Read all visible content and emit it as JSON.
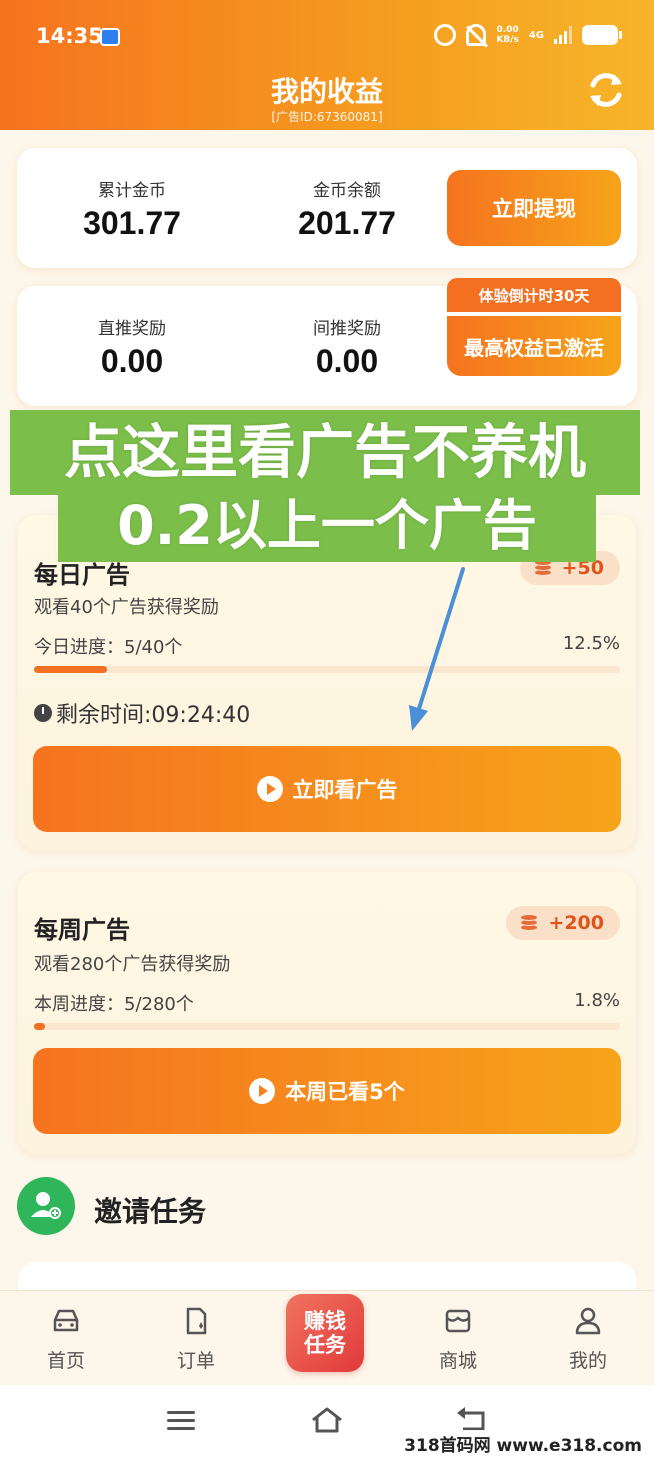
{
  "status_bar": {
    "time": "14:35",
    "net_speed_value": "0.00",
    "net_speed_unit": "KB/s",
    "network": "4G"
  },
  "header": {
    "title": "我的收益",
    "ad_id": "[广告ID:67360081]"
  },
  "balance_card": {
    "total_coins_label": "累计金币",
    "total_coins_value": "301.77",
    "coin_balance_label": "金币余额",
    "coin_balance_value": "201.77",
    "withdraw_button": "立即提现"
  },
  "reward_card": {
    "direct_label": "直推奖励",
    "direct_value": "0.00",
    "indirect_label": "间推奖励",
    "indirect_value": "0.00",
    "trial_badge": "体验倒计时30天",
    "rights_button": "最高权益已激活"
  },
  "overlay": {
    "line1": "点这里看广告不养机",
    "line2": "0.2以上一个广告"
  },
  "daily_task": {
    "title": "每日广告",
    "reward": "+50",
    "description": "观看40个广告获得奖励",
    "progress_label": "今日进度：5/40个",
    "progress_percent_text": "12.5%",
    "progress_fraction": 0.125,
    "timer_label": "剩余时间:09:24:40",
    "button": "立即看广告"
  },
  "weekly_task": {
    "title": "每周广告",
    "reward": "+200",
    "description": "观看280个广告获得奖励",
    "progress_label": "本周进度：5/280个",
    "progress_percent_text": "1.8%",
    "progress_fraction": 0.018,
    "button": "本周已看5个"
  },
  "invite": {
    "title": "邀请任务"
  },
  "tabbar": {
    "home": "首页",
    "orders": "订单",
    "center_line1": "赚钱",
    "center_line2": "任务",
    "mall": "商城",
    "mine": "我的"
  },
  "watermark": "318首码网 www.e318.com",
  "colors": {
    "brand_orange": "#f6731f",
    "overlay_green": "#7bbf4a",
    "invite_green": "#2fb55a",
    "annotation_arrow": "#4a8fd8"
  }
}
